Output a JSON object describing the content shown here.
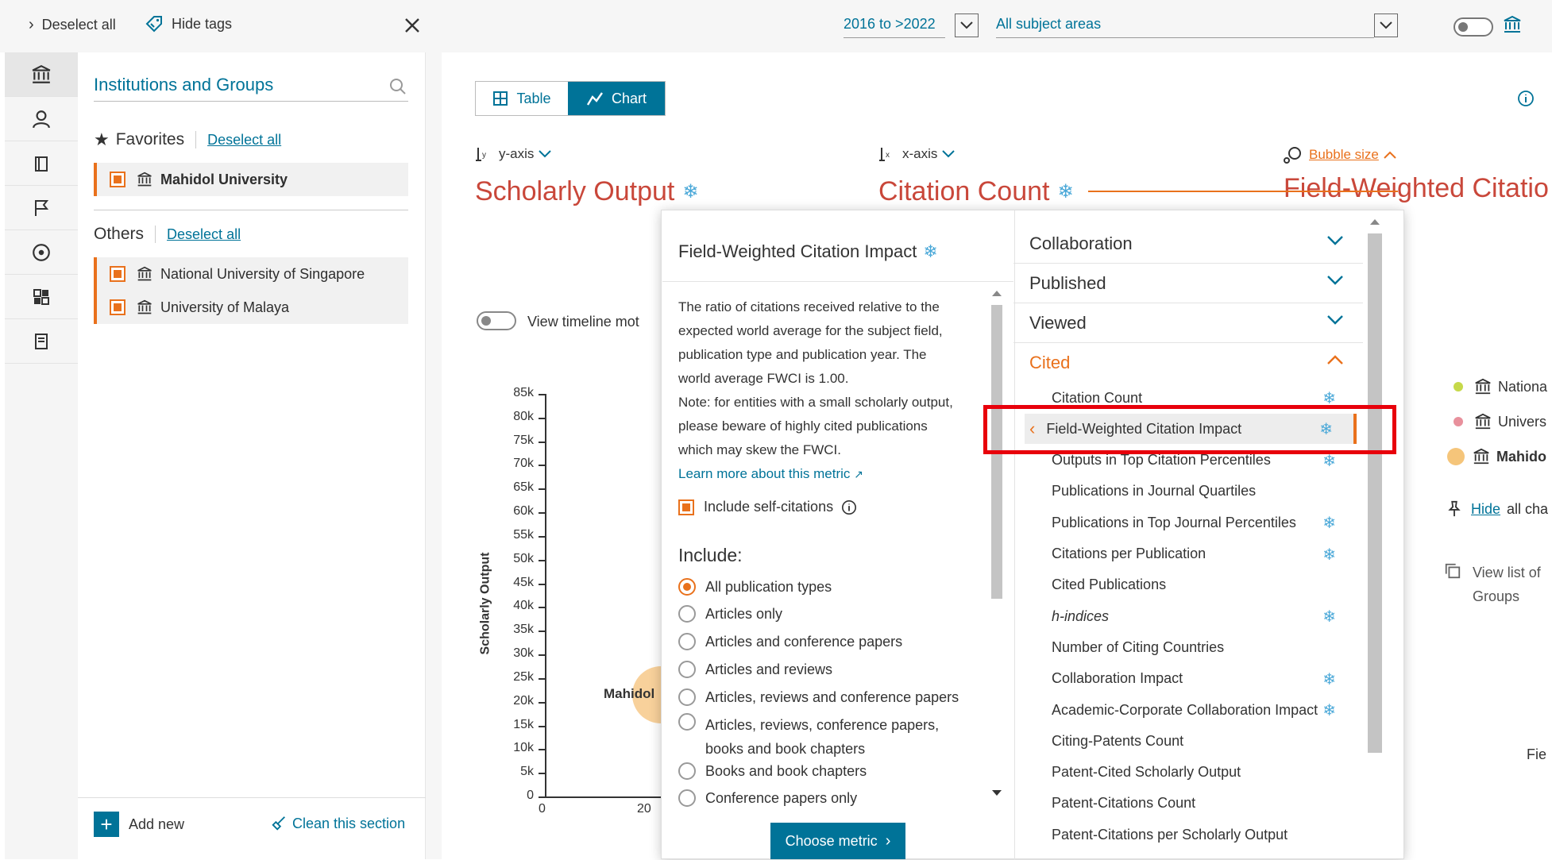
{
  "topbar": {
    "deselect_all": "Deselect all",
    "hide_tags": "Hide tags",
    "year_range": "2016 to >2022",
    "subject_areas": "All subject areas"
  },
  "panel": {
    "title": "Institutions and Groups",
    "favorites_label": "Favorites",
    "favorites_deselect": "Deselect all",
    "favorites": [
      {
        "name": "Mahidol University"
      }
    ],
    "others_label": "Others",
    "others_deselect": "Deselect all",
    "others": [
      {
        "name": "National University of Singapore"
      },
      {
        "name": "University of Malaya"
      }
    ],
    "add_new": "Add new",
    "clean_section": "Clean this section"
  },
  "view_toggle": {
    "table": "Table",
    "chart": "Chart",
    "active": "Chart"
  },
  "axes": {
    "y_label": "y-axis",
    "y_metric": "Scholarly Output",
    "x_label": "x-axis",
    "x_metric": "Citation Count",
    "bubble_label": "Bubble size",
    "bubble_metric": "Field-Weighted Citatio"
  },
  "timeline_toggle": "View timeline mot",
  "chart_data": {
    "type": "scatter",
    "ylabel": "Scholarly Output",
    "y_ticks": [
      "0",
      "5k",
      "10k",
      "15k",
      "20k",
      "25k",
      "30k",
      "35k",
      "40k",
      "45k",
      "50k",
      "55k",
      "60k",
      "65k",
      "70k",
      "75k",
      "80k",
      "85k"
    ],
    "x_ticks": [
      "0",
      "20"
    ],
    "ylim": [
      0,
      85000
    ],
    "points": [
      {
        "label": "Mahidol",
        "y": 21500
      }
    ]
  },
  "dropdown": {
    "title": "Field-Weighted Citation Impact",
    "description_lines": [
      "The ratio of citations received relative to the",
      "expected world average for the subject field,",
      "publication type and publication year. The",
      "world average FWCI is 1.00.",
      "Note: for entities with a small scholarly output,",
      "please beware of highly cited publications",
      "which may skew the FWCI."
    ],
    "learn_more": "Learn more about this metric",
    "self_citations": "Include self-citations",
    "include_label": "Include:",
    "options": [
      {
        "label": "All publication types",
        "selected": true
      },
      {
        "label": "Articles only",
        "selected": false
      },
      {
        "label": "Articles and conference papers",
        "selected": false
      },
      {
        "label": "Articles and reviews",
        "selected": false
      },
      {
        "label": "Articles, reviews and conference papers",
        "selected": false
      },
      {
        "label": "Articles, reviews, conference papers,",
        "selected": false
      },
      {
        "label": "Books and book chapters",
        "selected": false
      },
      {
        "label": "Conference papers only",
        "selected": false
      }
    ],
    "option_wrap": "books and book chapters",
    "choose_button": "Choose metric",
    "categories": [
      {
        "label": "Collaboration",
        "expanded": false
      },
      {
        "label": "Published",
        "expanded": false
      },
      {
        "label": "Viewed",
        "expanded": false
      },
      {
        "label": "Cited",
        "expanded": true
      }
    ],
    "metrics": [
      {
        "label": "Citation Count",
        "gear": true
      },
      {
        "label": "Field-Weighted Citation Impact",
        "gear": true,
        "selected": true
      },
      {
        "label": "Outputs in Top Citation Percentiles",
        "gear": true
      },
      {
        "label": "Publications in Journal Quartiles",
        "gear": false
      },
      {
        "label": "Publications in Top Journal Percentiles",
        "gear": true
      },
      {
        "label": "Citations per Publication",
        "gear": true
      },
      {
        "label": "Cited Publications",
        "gear": false
      },
      {
        "label": "h-indices",
        "gear": true
      },
      {
        "label": "Number of Citing Countries",
        "gear": false
      },
      {
        "label": "Collaboration Impact",
        "gear": true
      },
      {
        "label": "Academic-Corporate Collaboration Impact",
        "gear": true
      },
      {
        "label": "Citing-Patents Count",
        "gear": false
      },
      {
        "label": "Patent-Cited Scholarly Output",
        "gear": false
      },
      {
        "label": "Patent-Citations Count",
        "gear": false
      },
      {
        "label": "Patent-Citations per Scholarly Output",
        "gear": false
      }
    ]
  },
  "legend": {
    "items": [
      {
        "label": "Nationa",
        "color": "#c6d94a"
      },
      {
        "label": "Univers",
        "color": "#e8909c"
      },
      {
        "label": "Mahido",
        "color": "#f5c57a"
      }
    ],
    "hide_link": "Hide",
    "hide_rest": "all cha",
    "view_list_1": "View list of",
    "view_list_2": "Groups",
    "fie_label": "Fie"
  },
  "colors": {
    "accent": "#e9711c",
    "teal": "#007398",
    "highlight": "#e8000b"
  }
}
